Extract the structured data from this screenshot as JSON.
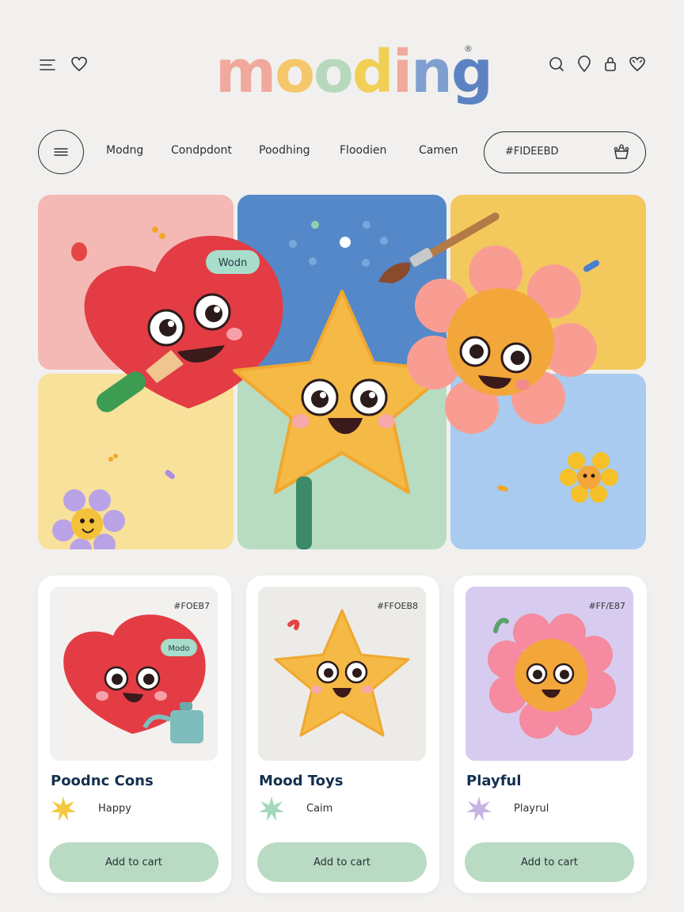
{
  "header": {
    "logo_letters": [
      "m",
      "o",
      "o",
      "d",
      "i",
      "n",
      "g"
    ],
    "logo_colors": [
      "#f0a99c",
      "#f6c66a",
      "#b6d8bd",
      "#f2cf55",
      "#f0a99c",
      "#7f9fd0",
      "#5b83c3"
    ],
    "logo_mark": "®",
    "left_icons": [
      "menu-icon",
      "heart-icon"
    ],
    "right_icons": [
      "search-icon",
      "location-pin-icon",
      "lock-icon",
      "heart-icon"
    ]
  },
  "nav": {
    "links": [
      "Modng",
      "Condpdont",
      "Poodhing",
      "Floodien",
      "Camen"
    ],
    "search_value": "#FIDEEBD",
    "search_icon": "basket-icon"
  },
  "hero": {
    "tile_colors": [
      "#f4b9b5",
      "#5588c8",
      "#f3c95e",
      "#f8e19a",
      "#b8dcc1",
      "#a9cbef"
    ],
    "heart_tag": "Wodn"
  },
  "products": [
    {
      "hex": "#FOEB7",
      "title": "Poodnc Cons",
      "mood": "Happy",
      "mood_color": "#f4c83f",
      "image_bg": "#f2f1ef",
      "tag": "Modo",
      "cta": "Add to cart"
    },
    {
      "hex": "#FFOEB8",
      "title": "Mood Toys",
      "mood": "Caim",
      "mood_color": "#a4d8b8",
      "image_bg": "#ecebe8",
      "cta": "Add to cart"
    },
    {
      "hex": "#FF/E87",
      "title": "Playful",
      "mood": "Playrul",
      "mood_color": "#c7b2e4",
      "image_bg": "#d7ccef",
      "cta": "Add to cart"
    }
  ]
}
